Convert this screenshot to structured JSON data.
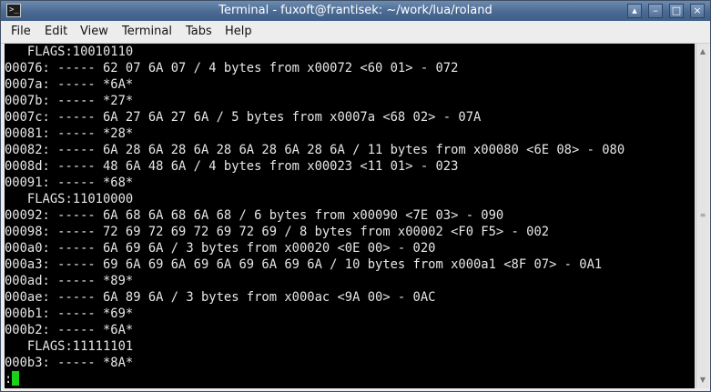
{
  "window": {
    "title": "Terminal - fuxoft@frantisek: ~/work/lua/roland",
    "app_icon_glyph": ">_",
    "controls": {
      "shade": "▴",
      "minimize": "–",
      "maximize": "□",
      "close": "×"
    }
  },
  "menu": {
    "file": "File",
    "edit": "Edit",
    "view": "View",
    "terminal": "Terminal",
    "tabs": "Tabs",
    "help": "Help"
  },
  "terminal": {
    "lines": [
      "   FLAGS:10010110",
      "00076: ----- 62 07 6A 07 / 4 bytes from x00072 <60 01> - 072",
      "0007a: ----- *6A*",
      "0007b: ----- *27*",
      "0007c: ----- 6A 27 6A 27 6A / 5 bytes from x0007a <68 02> - 07A",
      "00081: ----- *28*",
      "00082: ----- 6A 28 6A 28 6A 28 6A 28 6A 28 6A / 11 bytes from x00080 <6E 08> - 080",
      "0008d: ----- 48 6A 48 6A / 4 bytes from x00023 <11 01> - 023",
      "00091: ----- *68*",
      "   FLAGS:11010000",
      "00092: ----- 6A 68 6A 68 6A 68 / 6 bytes from x00090 <7E 03> - 090",
      "00098: ----- 72 69 72 69 72 69 72 69 / 8 bytes from x00002 <F0 F5> - 002",
      "000a0: ----- 6A 69 6A / 3 bytes from x00020 <0E 00> - 020",
      "000a3: ----- 69 6A 69 6A 69 6A 69 6A 69 6A / 10 bytes from x000a1 <8F 07> - 0A1",
      "000ad: ----- *89*",
      "000ae: ----- 6A 89 6A / 3 bytes from x000ac <9A 00> - 0AC",
      "000b1: ----- *69*",
      "000b2: ----- *6A*",
      "   FLAGS:11111101",
      "000b3: ----- *8A*"
    ],
    "prompt": ":"
  },
  "colors": {
    "terminal_bg": "#000000",
    "terminal_fg": "#e6e6e6",
    "cursor": "#16d416",
    "titlebar": "#4a6a93"
  },
  "icons": {
    "scroll_up": "▲",
    "scroll_down": "▼",
    "scroll_grip": "≡"
  }
}
